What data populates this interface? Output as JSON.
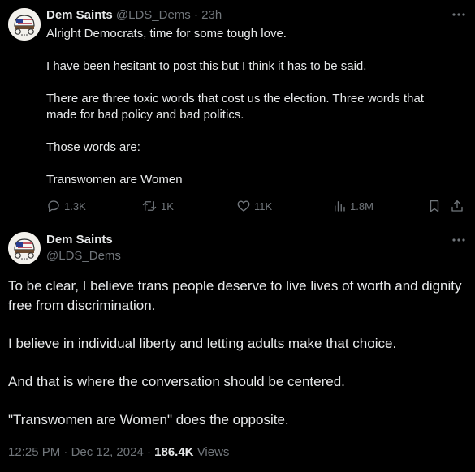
{
  "tweet1": {
    "display_name": "Dem Saints",
    "handle": "@LDS_Dems",
    "separator": "·",
    "time_ago": "23h",
    "paragraphs": [
      "Alright Democrats, time for some tough love.",
      "I have been hesitant to post this but I think it has to be said.",
      "There are three toxic words that cost us the election. Three words that made for bad policy and bad politics.",
      "Those words are:",
      "Transwomen are Women"
    ],
    "actions": {
      "replies": "1.3K",
      "reposts": "1K",
      "likes": "11K",
      "views": "1.8M"
    }
  },
  "tweet2": {
    "display_name": "Dem Saints",
    "handle": "@LDS_Dems",
    "paragraphs": [
      "To be clear, I believe trans people deserve to live lives of worth and dignity free from discrimination.",
      "I believe in individual liberty and letting adults make that choice.",
      "And that is where the conversation should be centered.",
      "\"Transwomen are Women\" does the opposite."
    ],
    "meta": {
      "time": "12:25 PM",
      "separator": "·",
      "date": "Dec 12, 2024",
      "views_count": "186.4K",
      "views_label": "Views"
    }
  },
  "icons": {
    "more": "more-horizontal-icon",
    "reply": "reply-bubble-icon",
    "repost": "repost-icon",
    "like": "heart-icon",
    "views": "views-bar-chart-icon",
    "bookmark": "bookmark-icon",
    "share": "share-icon"
  },
  "colors": {
    "background": "#000000",
    "text_primary": "#e7e9ea",
    "text_secondary": "#71767b"
  }
}
